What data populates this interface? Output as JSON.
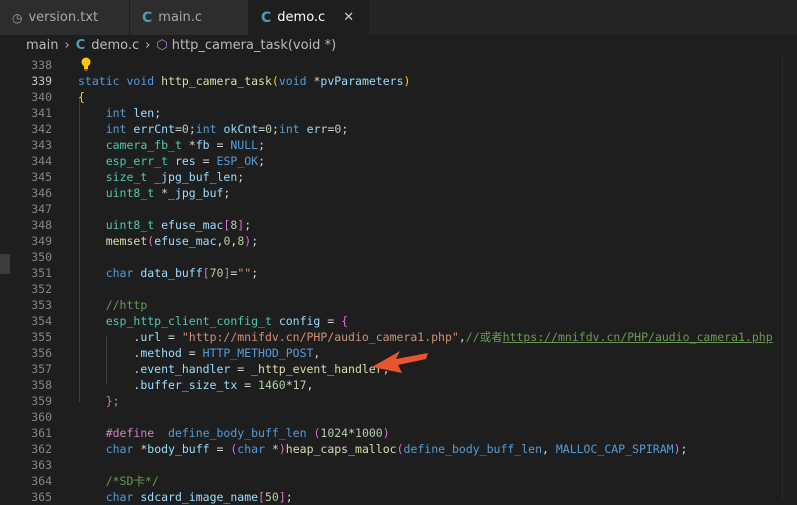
{
  "tabs": [
    {
      "icon": "clock-icon",
      "label": "version.txt",
      "active": false
    },
    {
      "icon": "c-file-icon",
      "label": "main.c",
      "active": false
    },
    {
      "icon": "c-file-icon",
      "label": "demo.c",
      "active": true,
      "close": "✕"
    }
  ],
  "breadcrumb": {
    "folder": "main",
    "file": "demo.c",
    "symbol": "http_camera_task(void *)"
  },
  "line_numbers": [
    "338",
    "339",
    "340",
    "341",
    "342",
    "343",
    "344",
    "345",
    "346",
    "347",
    "348",
    "349",
    "350",
    "351",
    "352",
    "353",
    "354",
    "355",
    "356",
    "357",
    "358",
    "359",
    "360",
    "361",
    "362",
    "363",
    "364",
    "365"
  ],
  "current_line": "339",
  "colors": {
    "keyword": "#569cd6",
    "type": "#4ec9b0",
    "function": "#dcdcaa",
    "variable": "#9cdcfe",
    "number": "#b5cea8",
    "string": "#ce9178",
    "comment": "#6a9955",
    "annotation_arrow": "#e8552f"
  },
  "code": {
    "l339": {
      "kw1": "static",
      "kw2": "void",
      "fn": "http_camera_task",
      "p1": "(",
      "kw3": "void",
      "rest": " *",
      "vr": "pvParameters",
      "p2": ")"
    },
    "l340": "{",
    "l341": {
      "kw": "int",
      "vr": "len",
      "end": ";"
    },
    "l342": {
      "kw1": "int",
      "v1": "errCnt",
      "n1": "0",
      "kw2": "int",
      "v2": "okCnt",
      "n2": "0",
      "kw3": "int",
      "v3": "err",
      "n3": "0"
    },
    "l343": {
      "ty": "camera_fb_t",
      "vr": "fb",
      "mc": "NULL"
    },
    "l344": {
      "ty": "esp_err_t",
      "vr": "res",
      "mc": "ESP_OK"
    },
    "l345": {
      "ty": "size_t",
      "vr": "_jpg_buf_len"
    },
    "l346": {
      "ty": "uint8_t",
      "vr": "_jpg_buf"
    },
    "l348": {
      "ty": "uint8_t",
      "vr": "efuse_mac",
      "n": "8"
    },
    "l349": {
      "fn": "memset",
      "vr": "efuse_mac",
      "n1": "0",
      "n2": "8"
    },
    "l351": {
      "kw": "char",
      "vr": "data_buff",
      "n": "70",
      "st": "\"\""
    },
    "l353": "//http",
    "l354": {
      "ty": "esp_http_client_config_t",
      "vr": "config"
    },
    "l355": {
      "vr": "url",
      "st": "\"http://mnifdv.cn/PHP/audio_camera1.php\"",
      "cm": "//或者",
      "link": "https://mnifdv.cn/PHP/audio_camera1.php"
    },
    "l356": {
      "vr": "method",
      "mc": "HTTP_METHOD_POST"
    },
    "l357": {
      "vr": "event_handler",
      "fn": "_http_event_handler"
    },
    "l358": {
      "vr": "buffer_size_tx",
      "n1": "1460",
      "n2": "17"
    },
    "l359": "};",
    "l361": {
      "pp": "#define",
      "mc": "define_body_buff_len",
      "n1": "1024",
      "n2": "1000"
    },
    "l362": {
      "kw": "char",
      "vr": "body_buff",
      "kw2": "char",
      "fn": "heap_caps_malloc",
      "mc1": "define_body_buff_len",
      "mc2": "MALLOC_CAP_SPIRAM"
    },
    "l364": "/*SD卡*/",
    "l365": {
      "kw": "char",
      "vr": "sdcard_image_name",
      "n": "50"
    }
  }
}
